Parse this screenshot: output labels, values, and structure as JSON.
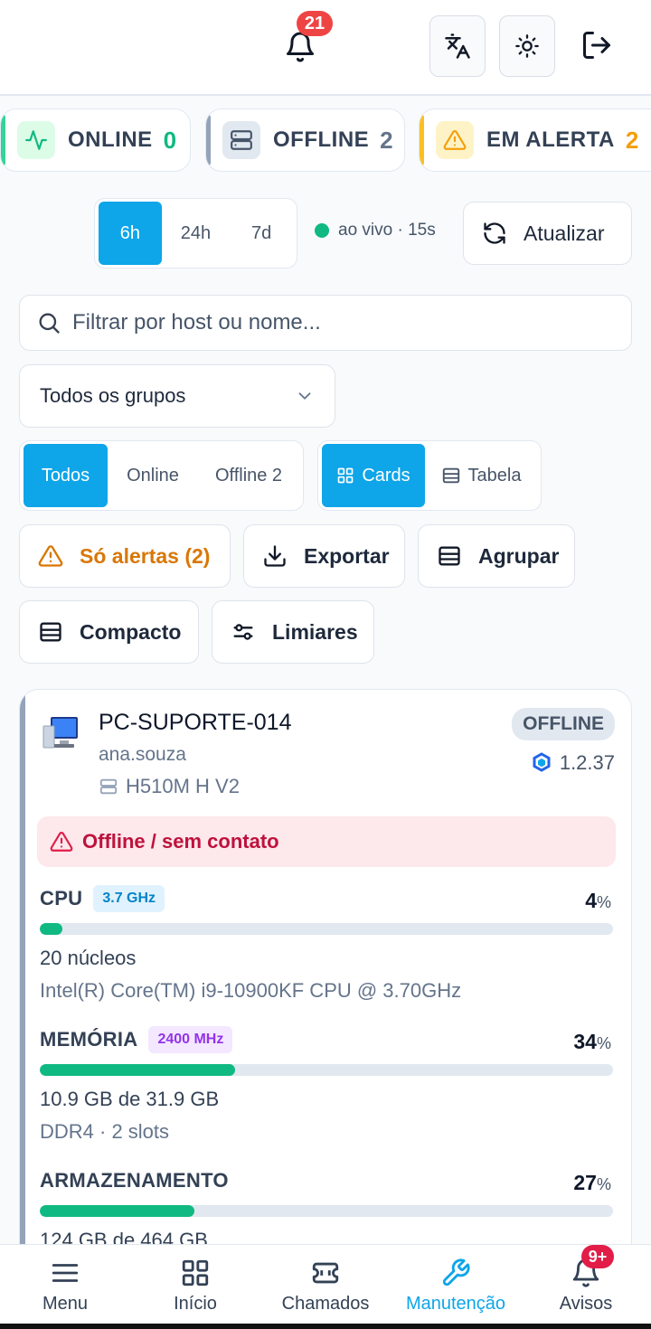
{
  "header": {
    "notifications_count": "21"
  },
  "status": {
    "online": {
      "label": "ONLINE",
      "count": "0",
      "color": "#10b981"
    },
    "offline": {
      "label": "OFFLINE",
      "count": "2",
      "color": "#64748b"
    },
    "alert": {
      "label": "EM ALERTA",
      "count": "2",
      "color": "#f59e0b"
    }
  },
  "range": {
    "options": [
      "6h",
      "24h",
      "7d"
    ],
    "selected": "6h",
    "live_text": "ao vivo · 15s",
    "refresh_label": "Atualizar"
  },
  "search": {
    "placeholder": "Filtrar por host ou nome..."
  },
  "group_select": {
    "value": "Todos os grupos"
  },
  "filters": {
    "status_options": [
      "Todos",
      "Online",
      "Offline 2"
    ],
    "status_selected": "Todos",
    "view_cards": "Cards",
    "view_table": "Tabela",
    "view_selected": "Cards"
  },
  "actions": {
    "only_alerts": "Só alertas (2)",
    "export": "Exportar",
    "group": "Agrupar",
    "compact": "Compacto",
    "thresholds": "Limiares"
  },
  "card": {
    "hostname": "PC-SUPORTE-014",
    "user": "ana.souza",
    "board": "H510M H V2",
    "status_badge": "OFFLINE",
    "version": "1.2.37",
    "alert_text": "Offline / sem contato",
    "cpu": {
      "label": "CPU",
      "tag": "3.7 GHz",
      "percent": "4",
      "percent_value": 4,
      "line1": "20 núcleos",
      "line2": "Intel(R) Core(TM) i9-10900KF CPU @ 3.70GHz"
    },
    "memory": {
      "label": "MEMÓRIA",
      "tag": "2400 MHz",
      "percent": "34",
      "percent_value": 34,
      "line1": "10.9 GB de 31.9 GB",
      "line2": "DDR4 · 2 slots"
    },
    "storage": {
      "label": "ARMAZENAMENTO",
      "percent": "27",
      "percent_value": 27,
      "line1": "124 GB de 464 GB"
    }
  },
  "bottom_nav": {
    "items": [
      "Menu",
      "Início",
      "Chamados",
      "Manutenção",
      "Avisos"
    ],
    "active": "Manutenção",
    "avisos_badge": "9+"
  }
}
